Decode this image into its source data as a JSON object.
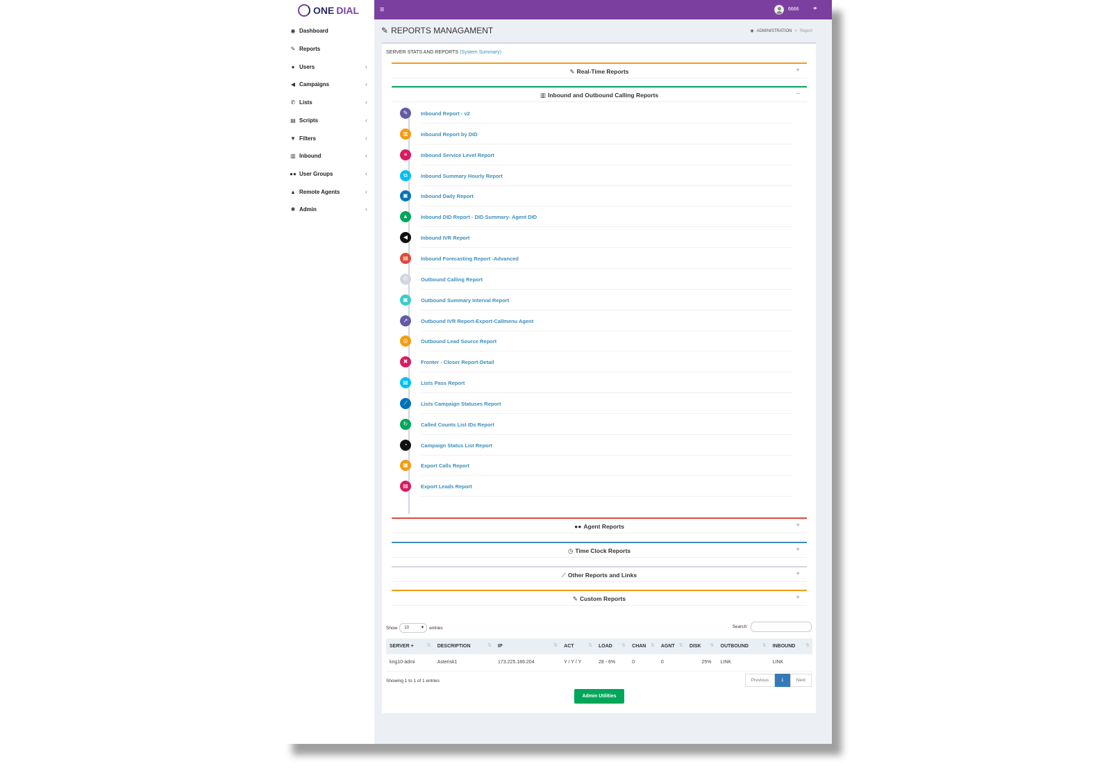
{
  "brand": {
    "one": "ONE",
    "dial": "DIAL"
  },
  "topbar": {
    "username": "6666",
    "menu_icon": "hamburger-icon",
    "share_icon": "share-icon"
  },
  "sidebar": {
    "items": [
      {
        "label": "Dashboard",
        "icon": "dashboard-icon",
        "chevron": false
      },
      {
        "label": "Reports",
        "icon": "edit-icon",
        "chevron": false
      },
      {
        "label": "Users",
        "icon": "user-icon",
        "chevron": true
      },
      {
        "label": "Campaigns",
        "icon": "bullhorn-icon",
        "chevron": true
      },
      {
        "label": "Lists",
        "icon": "phone-icon",
        "chevron": true
      },
      {
        "label": "Scripts",
        "icon": "file-icon",
        "chevron": true
      },
      {
        "label": "Filters",
        "icon": "filter-icon",
        "chevron": true
      },
      {
        "label": "Inbound",
        "icon": "bar-chart-icon",
        "chevron": true
      },
      {
        "label": "User Groups",
        "icon": "users-icon",
        "chevron": true
      },
      {
        "label": "Remote Agents",
        "icon": "lock-user-icon",
        "chevron": true
      },
      {
        "label": "Admin",
        "icon": "gear-icon",
        "chevron": true
      }
    ]
  },
  "header": {
    "title": "REPORTS MANAGAMENT",
    "breadcrumb": [
      "ADMINISTRATION",
      ">",
      "Report"
    ]
  },
  "box": {
    "heading": "SERVER STATS AND REPORTS",
    "summary_link": "(System Summary)"
  },
  "panels": {
    "realtime": {
      "title": "Real-Time Reports",
      "toggle": "+",
      "color": "#f39c12"
    },
    "calling": {
      "title": "Inbound and Outbound Calling Reports",
      "toggle": "−",
      "color": "#00a65a"
    },
    "agent": {
      "title": "Agent Reports",
      "toggle": "+",
      "color": "#dd4b39"
    },
    "timeclock": {
      "title": "Time Clock Reports",
      "toggle": "+",
      "color": "#3c8dbc"
    },
    "other": {
      "title": "Other Reports and Links",
      "toggle": "+",
      "color": "#d2d6de"
    },
    "custom": {
      "title": "Custom Reports",
      "toggle": "+",
      "color": "#f39c12"
    }
  },
  "reports": [
    {
      "label": "Inbound Report - v2",
      "color": "#605ca8"
    },
    {
      "label": "Inbound Report by DID",
      "color": "#f39c12"
    },
    {
      "label": "Inbound Service Level Report",
      "color": "#d81b60"
    },
    {
      "label": "Inbound Summary Hourly Report",
      "color": "#00c0ef"
    },
    {
      "label": "Inbound Daily Report",
      "color": "#0073b7"
    },
    {
      "label": "Inbound DID Report - DID Summary- Agent DID",
      "color": "#00a65a"
    },
    {
      "label": "Inbound IVR Report",
      "color": "#111111"
    },
    {
      "label": "Inbound Forecasting Report -Advanced",
      "color": "#dd4b39"
    },
    {
      "label": "Outbound Calling Report",
      "color": "#d2d6de"
    },
    {
      "label": "Outbound Summary Interval Report",
      "color": "#39cccc"
    },
    {
      "label": "Outbound IVR Report-Export-Callmenu Agent",
      "color": "#605ca8"
    },
    {
      "label": "Outbound Lead Source Report",
      "color": "#f39c12"
    },
    {
      "label": "Fronter - Closer Report-Detail",
      "color": "#d81b60"
    },
    {
      "label": "Lists Pass Report",
      "color": "#00c0ef"
    },
    {
      "label": "Lists Campaign Statuses Report",
      "color": "#0073b7"
    },
    {
      "label": "Called Counts List IDs Report",
      "color": "#00a65a"
    },
    {
      "label": "Campaign Status List Report",
      "color": "#111111"
    },
    {
      "label": "Export Calls Report",
      "color": "#f39c12"
    },
    {
      "label": "Export Leads Report",
      "color": "#d81b60"
    }
  ],
  "table": {
    "show_label": "Show",
    "entries_value": "10",
    "entries_label": "entries",
    "search_label": "Search:",
    "headers": [
      "SERVER +",
      "DESCRIPTION",
      "IP",
      "ACT",
      "LOAD",
      "CHAN",
      "AGNT",
      "DISK",
      "OUTBOUND",
      "INBOUND"
    ],
    "rows": [
      [
        "kng10-admi",
        "Asterisk1",
        "173.225.186.204",
        "Y / Y / Y",
        "28 - 6%",
        "0",
        "0",
        "25%",
        "LINK",
        "LINK"
      ]
    ],
    "info": "Showing 1 to 1 of 1 entries",
    "pager": {
      "previous": "Previous",
      "current": "1",
      "next": "Next"
    }
  },
  "admin_button": "Admin Utilities"
}
